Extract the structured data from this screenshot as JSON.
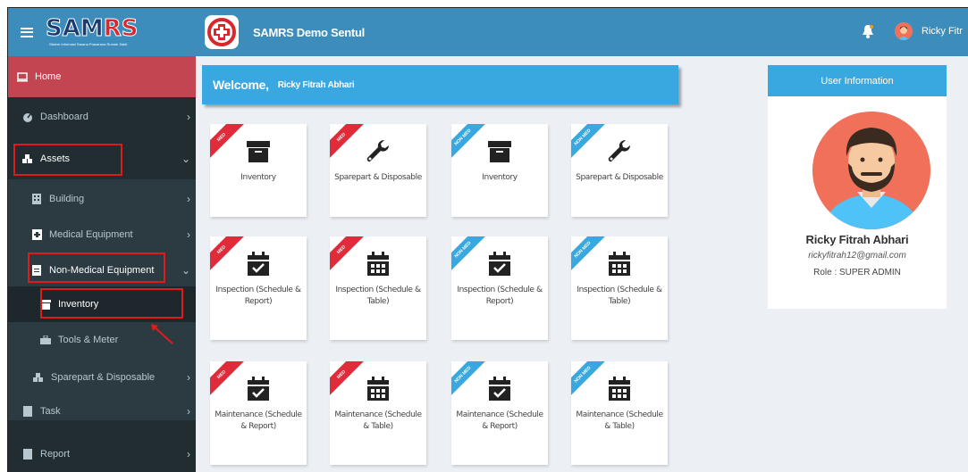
{
  "brand": {
    "logo_main": "SAM",
    "logo_accent": "RS",
    "logo_tagline": "Sistem Informasi Sarana Prasarana Rumah Sakit"
  },
  "header": {
    "title": "SAMRS Demo Sentul",
    "user_name": "Ricky Fitr"
  },
  "sidebar": {
    "items": [
      {
        "label": "Home"
      },
      {
        "label": "Dashboard"
      },
      {
        "label": "Assets"
      },
      {
        "label": "Building"
      },
      {
        "label": "Medical Equipment"
      },
      {
        "label": "Non-Medical Equipment"
      },
      {
        "label": "Inventory"
      },
      {
        "label": "Tools & Meter"
      },
      {
        "label": "Sparepart & Disposable"
      },
      {
        "label": "Task"
      },
      {
        "label": "Report"
      }
    ]
  },
  "welcome": {
    "greeting": "Welcome,",
    "name": "Ricky Fitrah Abhari"
  },
  "ribbons": {
    "med": "MED",
    "non_med": "NON MED"
  },
  "tiles": {
    "row1": [
      {
        "label": "Inventory"
      },
      {
        "label": "Sparepart & Disposable"
      },
      {
        "label": "Inventory"
      },
      {
        "label": "Sparepart & Disposable"
      }
    ],
    "row2": [
      {
        "label": "Inspection (Schedule & Report)"
      },
      {
        "label": "Inspection (Schedule & Table)"
      },
      {
        "label": "Inspection (Schedule & Report)"
      },
      {
        "label": "Inspection (Schedule & Table)"
      }
    ],
    "row3": [
      {
        "label": "Maintenance (Schedule & Report)"
      },
      {
        "label": "Maintenance (Schedule & Table)"
      },
      {
        "label": "Maintenance (Schedule & Report)"
      },
      {
        "label": "Maintenance (Schedule & Table)"
      }
    ]
  },
  "user_info": {
    "heading": "User Information",
    "name": "Ricky Fitrah Abhari",
    "email": "rickyfitrah12@gmail.com",
    "role": "Role : SUPER ADMIN"
  },
  "colors": {
    "header_blue": "#3c8dbc",
    "accent_blue": "#3aa8e0",
    "sidebar_dark": "#222d32",
    "home_red": "#c44552",
    "med_red": "#e02b3a",
    "highlight_red": "#e01b1b"
  }
}
